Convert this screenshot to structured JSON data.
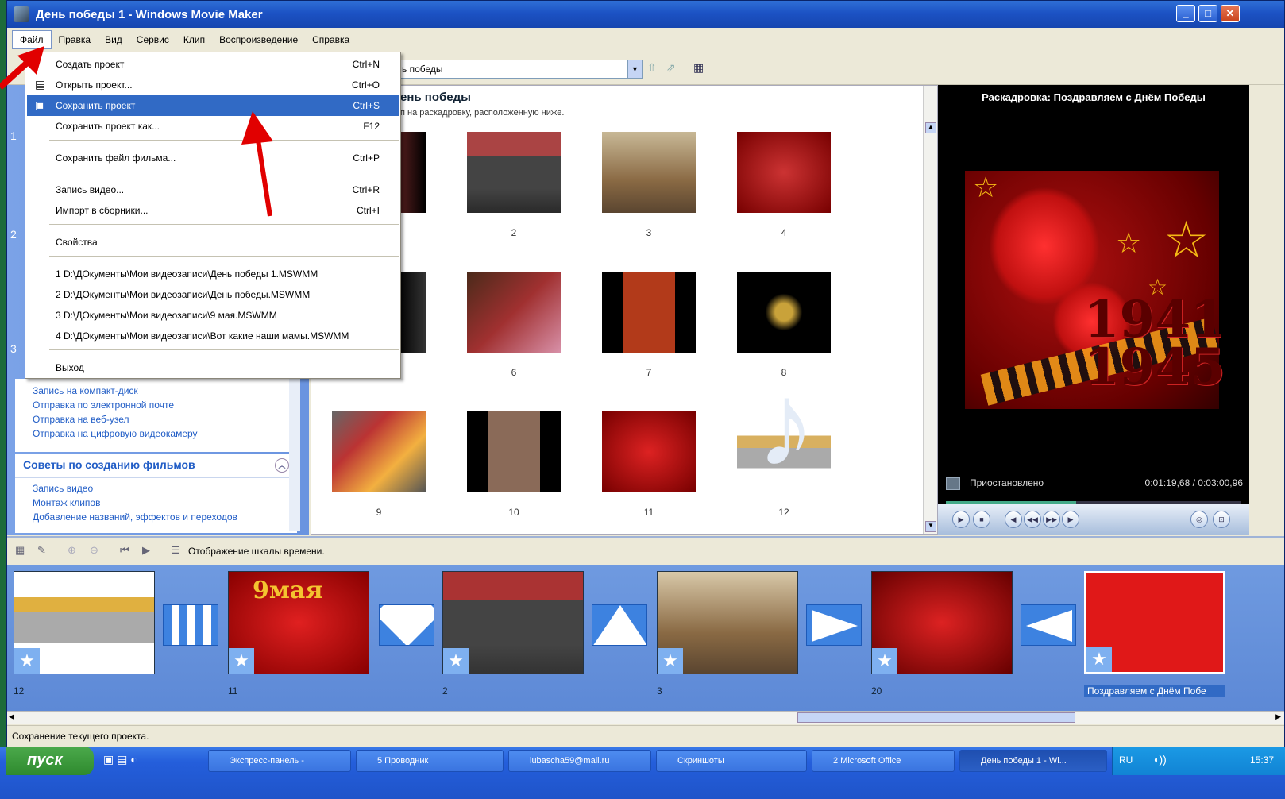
{
  "window": {
    "title": "День победы 1 - Windows Movie Maker"
  },
  "menu": [
    "Файл",
    "Правка",
    "Вид",
    "Сервис",
    "Клип",
    "Воспроизведение",
    "Справка"
  ],
  "toolbar": {
    "collection_value": "ь победы"
  },
  "file_menu": {
    "items": [
      {
        "label": "Создать проект",
        "key": "Ctrl+N"
      },
      {
        "label": "Открыть проект...",
        "key": "Ctrl+O"
      },
      {
        "label": "Сохранить проект",
        "key": "Ctrl+S"
      },
      {
        "label": "Сохранить проект как...",
        "key": "F12"
      },
      {
        "label": "Сохранить файл фильма...",
        "key": "Ctrl+P"
      },
      {
        "label": "Запись видео...",
        "key": "Ctrl+R"
      },
      {
        "label": "Импорт в сборники...",
        "key": "Ctrl+I"
      },
      {
        "label": "Свойства",
        "key": ""
      },
      {
        "label": "1 D:\\ДОкументы\\Мои видеозаписи\\День победы 1.MSWMM",
        "key": ""
      },
      {
        "label": "2 D:\\ДОкументы\\Мои видеозаписи\\День победы.MSWMM",
        "key": ""
      },
      {
        "label": "3 D:\\ДОкументы\\Мои видеозаписи\\9 мая.MSWMM",
        "key": ""
      },
      {
        "label": "4 D:\\ДОкументы\\Мои видеозаписи\\Вот какие наши мамы.MSWMM",
        "key": ""
      },
      {
        "label": "Выход",
        "key": ""
      }
    ]
  },
  "taskpane": {
    "num1": "1",
    "num2": "2",
    "num3": "3",
    "links_top": [
      "Запись на компакт-диск",
      "Отправка по электронной почте",
      "Отправка на веб-узел",
      "Отправка на цифровую видеокамеру"
    ],
    "tips_title": "Советы по созданию фильмов",
    "tips_links": [
      "Запись видео",
      "Монтаж клипов",
      "Добавление названий, эффектов и переходов"
    ]
  },
  "collection": {
    "title": "ень победы",
    "subtitle": "п на раскадровку, расположенную ниже.",
    "numbers": [
      "2",
      "3",
      "4",
      "6",
      "7",
      "8",
      "9",
      "10",
      "11",
      "12"
    ]
  },
  "player": {
    "title": "Раскадровка: Поздравляем с Днём Победы",
    "years_top": "1941",
    "years_bottom": "1945",
    "status": "Приостановлено",
    "time": "0:01:19,68 / 0:03:00,96",
    "progress": 0.44
  },
  "storyboard": {
    "toggle_label": "Отображение шкалы времени.",
    "clip_numbers": [
      "12",
      "11",
      "2",
      "3",
      "20"
    ],
    "last_clip_label": "Поздравляем с Днём Побе",
    "clip2_text": "9мая"
  },
  "status_bar": "Сохранение текущего проекта.",
  "taskbar": {
    "start": "пуск",
    "items": [
      "Экспресс-панель -",
      "5 Проводник",
      "lubascha59@mail.ru",
      "Скриншоты",
      "2 Microsoft Office",
      "День победы 1 - Wi..."
    ],
    "lang": "RU",
    "clock": "15:37"
  }
}
